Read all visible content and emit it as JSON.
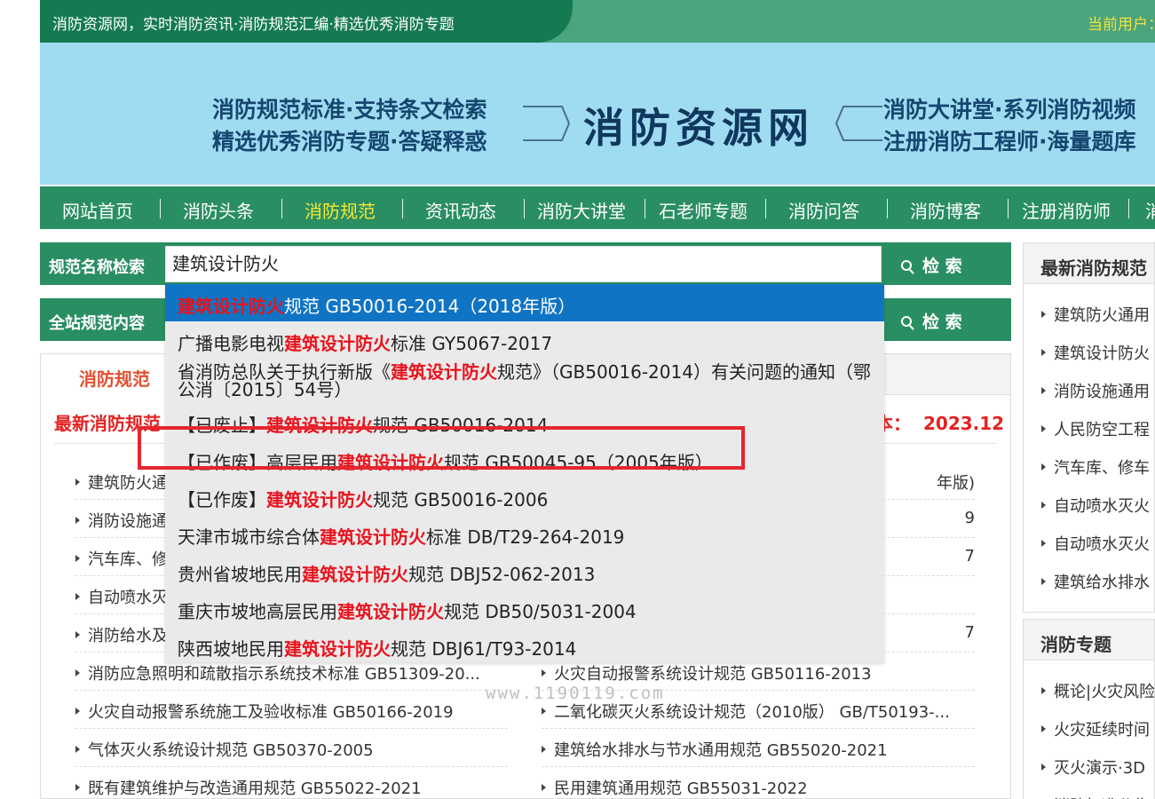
{
  "topbar": {
    "slogan": "消防资源网，实时消防资讯·消防规范汇编·精选优秀消防专题",
    "user": "当前用户："
  },
  "banner": {
    "left_line1": "消防规范标准·支持条文检索",
    "left_line2": "精选优秀消防专题·答疑释惑",
    "logo": "消防资源网",
    "right_line1": "消防大讲堂·系列消防视频",
    "right_line2": "注册消防工程师·海量题库"
  },
  "nav": {
    "items": [
      "网站首页",
      "消防头条",
      "消防规范",
      "资讯动态",
      "消防大讲堂",
      "石老师专题",
      "消防问答",
      "消防博客",
      "注册消防师",
      "消"
    ],
    "active_index": 2
  },
  "search_name": {
    "label": "规范名称检索",
    "value": "建筑设计防火",
    "button": "检 索"
  },
  "search_full": {
    "label": "全站规范内容",
    "button": "检 索"
  },
  "panel": {
    "tab": "消防规范",
    "latest": "最新消防规范",
    "version_label": "本：",
    "version_value": "2023.12",
    "left_list": [
      "建筑防火通",
      "消防设施通",
      "汽车库、修",
      "自动喷水灭",
      "消防给水及",
      "消防应急照明和疏散指示系统技术标准 GB51309-20...",
      "火灾自动报警系统施工及验收标准 GB50166-2019",
      "气体灭火系统设计规范 GB50370-2005",
      "既有建筑维护与改造通用规范 GB55022-2021"
    ],
    "right_list": [
      "年版)",
      "9",
      "7",
      "",
      "7",
      "火灾自动报警系统设计规范 GB50116-2013",
      "二氧化碳灭火系统设计规范（2010版） GB/T50193-...",
      "建筑给水排水与节水通用规范 GB55020-2021",
      "民用建筑通用规范 GB55031-2022"
    ],
    "watermark": "www.1190119.com"
  },
  "sidebar_latest": {
    "title": "最新消防规范",
    "items": [
      "建筑防火通用",
      "建筑设计防火",
      "消防设施通用",
      "人民防空工程",
      "汽车库、修车",
      "自动喷水灭火",
      "自动喷水灭火",
      "建筑给水排水"
    ]
  },
  "sidebar_topics": {
    "title": "消防专题",
    "items": [
      "概论|火灾风险",
      "火灾延续时间",
      "灭火演示·3D",
      "消防标准公告"
    ]
  },
  "dropdown": {
    "items": [
      {
        "pre": "",
        "hl": "建筑设计防火",
        "post": "规范 GB50016-2014（2018年版）"
      },
      {
        "pre": "广播电影电视",
        "hl": "建筑设计防火",
        "post": "标准 GY5067-2017"
      },
      {
        "pre": "省消防总队关于执行新版《",
        "hl": "建筑设计防火",
        "post": "规范》（GB50016-2014）有关问题的通知（鄂公消〔2015〕54号）"
      },
      {
        "pre": "【已废止】",
        "hl": "建筑设计防火",
        "post": "规范 GB50016-2014"
      },
      {
        "pre": "【已作废】高层民用",
        "hl": "建筑设计防火",
        "post": "规范 GB50045-95（2005年版）"
      },
      {
        "pre": "【已作废】",
        "hl": "建筑设计防火",
        "post": "规范 GB50016-2006"
      },
      {
        "pre": "天津市城市综合体",
        "hl": "建筑设计防火",
        "post": "标准 DB/T29-264-2019"
      },
      {
        "pre": "贵州省坡地民用",
        "hl": "建筑设计防火",
        "post": "规范 DBJ52-062-2013"
      },
      {
        "pre": "重庆市坡地高层民用",
        "hl": "建筑设计防火",
        "post": "规范 DB50/5031-2004"
      },
      {
        "pre": "陕西坡地民用",
        "hl": "建筑设计防火",
        "post": "规范 DBJ61/T93-2014"
      }
    ]
  }
}
